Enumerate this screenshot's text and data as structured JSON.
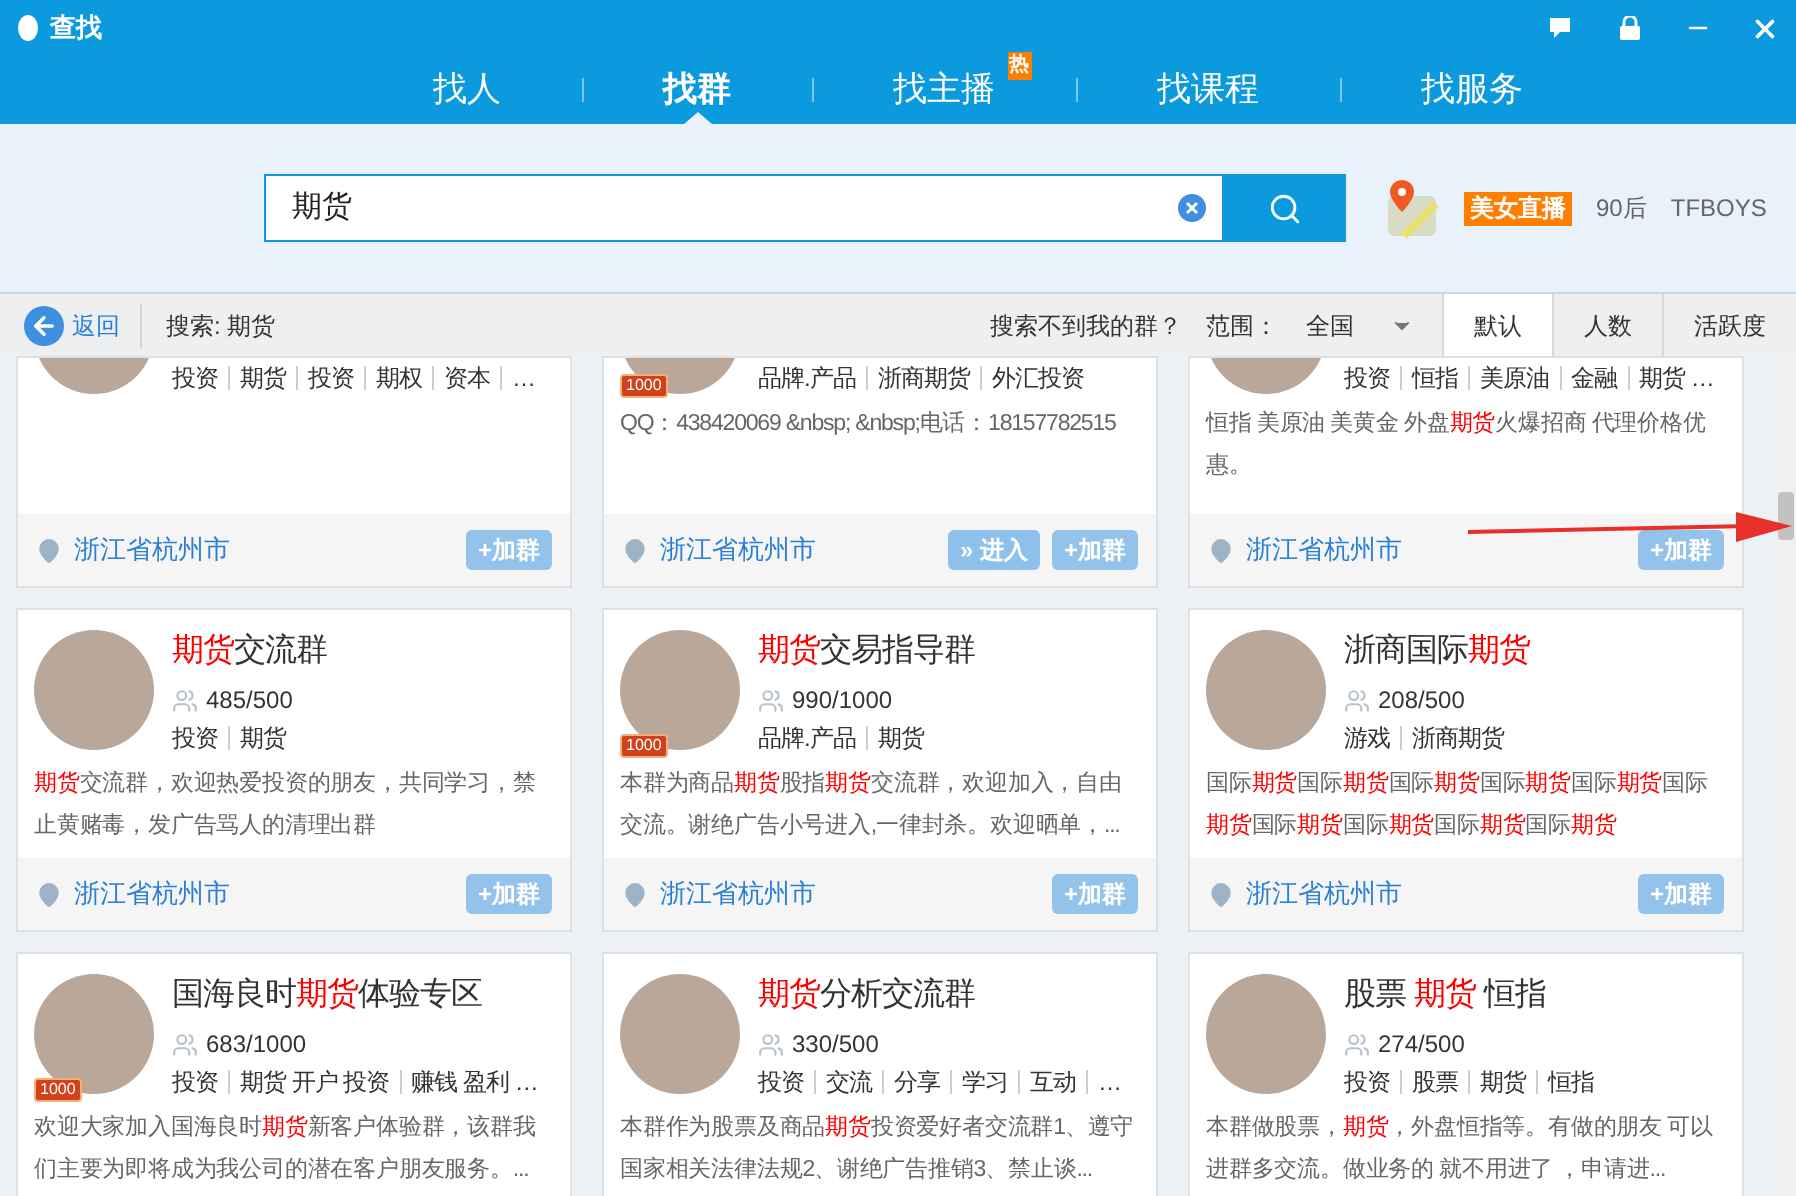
{
  "window": {
    "title": "查找"
  },
  "tabs": [
    {
      "label": "找人",
      "selected": false
    },
    {
      "label": "找群",
      "selected": true
    },
    {
      "label": "找主播",
      "selected": false,
      "badge": "热"
    },
    {
      "label": "找课程",
      "selected": false
    },
    {
      "label": "找服务",
      "selected": false
    }
  ],
  "search": {
    "value": "期货",
    "hot": [
      {
        "label": "美女直播",
        "kind": "badge"
      },
      {
        "label": "90后",
        "kind": "plain"
      },
      {
        "label": "TFBOYS",
        "kind": "plain"
      }
    ]
  },
  "toolbar": {
    "back": "返回",
    "query": "搜索: 期货",
    "help": "搜索不到我的群？",
    "range_label": "范围：",
    "range": "全国",
    "sorts": [
      {
        "label": "默认",
        "selected": true
      },
      {
        "label": "人数",
        "selected": false
      },
      {
        "label": "活跃度",
        "selected": false
      }
    ]
  },
  "rows": [
    {
      "cards": [
        {
          "tags": [
            "投资",
            "期货",
            "投资",
            "期权",
            "资本",
            "…"
          ],
          "location": "浙江省杭州市",
          "buttons": [
            {
              "label": "+加群",
              "kind": "join"
            }
          ]
        },
        {
          "badge": "1000",
          "tags": [
            "品牌.产品",
            "浙商期货",
            "外汇投资"
          ],
          "desc": [
            {
              "text": "QQ：438420069 &nbsp; &nbsp;电话：18157782515",
              "hl": false
            }
          ],
          "location": "浙江省杭州市",
          "buttons": [
            {
              "label": "» 进入",
              "kind": "enter"
            },
            {
              "label": "+加群",
              "kind": "join"
            }
          ]
        },
        {
          "tags": [
            "投资",
            "恒指",
            "美原油",
            "金融",
            "期货 …"
          ],
          "desc": [
            {
              "text": "恒指 美原油 美黄金 外盘",
              "hl": false
            },
            {
              "text": "期货",
              "hl": true
            },
            {
              "text": "火爆招商 代理价格优惠。",
              "hl": false
            }
          ],
          "location": "浙江省杭州市",
          "buttons": [
            {
              "label": "+加群",
              "kind": "join"
            }
          ]
        }
      ]
    },
    {
      "cards": [
        {
          "name": [
            {
              "text": "期货",
              "hl": true
            },
            {
              "text": "交流群",
              "hl": false
            }
          ],
          "count": "485/500",
          "tags": [
            "投资",
            "期货"
          ],
          "desc": [
            {
              "text": "期货",
              "hl": true
            },
            {
              "text": "交流群，欢迎热爱投资的朋友，共同学习，禁止黄赌毒，发广告骂人的清理出群",
              "hl": false
            }
          ],
          "location": "浙江省杭州市",
          "buttons": [
            {
              "label": "+加群",
              "kind": "join"
            }
          ]
        },
        {
          "badge": "1000",
          "name": [
            {
              "text": "期货",
              "hl": true
            },
            {
              "text": "交易指导群",
              "hl": false
            }
          ],
          "count": "990/1000",
          "tags": [
            "品牌.产品",
            "期货"
          ],
          "desc": [
            {
              "text": "本群为商品",
              "hl": false
            },
            {
              "text": "期货",
              "hl": true
            },
            {
              "text": "股指",
              "hl": false
            },
            {
              "text": "期货",
              "hl": true
            },
            {
              "text": "交流群，欢迎加入，自由交流。谢绝广告小号进入,一律封杀。欢迎晒单，...",
              "hl": false
            }
          ],
          "location": "浙江省杭州市",
          "buttons": [
            {
              "label": "+加群",
              "kind": "join"
            }
          ]
        },
        {
          "name": [
            {
              "text": "浙商国际",
              "hl": false
            },
            {
              "text": "期货",
              "hl": true
            }
          ],
          "count": "208/500",
          "tags": [
            "游戏",
            "浙商期货"
          ],
          "desc": [
            {
              "text": "国际",
              "hl": false
            },
            {
              "text": "期货",
              "hl": true
            },
            {
              "text": "国际",
              "hl": false
            },
            {
              "text": "期货",
              "hl": true
            },
            {
              "text": "国际",
              "hl": false
            },
            {
              "text": "期货",
              "hl": true
            },
            {
              "text": "国际",
              "hl": false
            },
            {
              "text": "期货",
              "hl": true
            },
            {
              "text": "国际",
              "hl": false
            },
            {
              "text": "期货",
              "hl": true
            },
            {
              "text": "国际",
              "hl": false
            },
            {
              "text": "期货",
              "hl": true
            },
            {
              "text": "国际",
              "hl": false
            },
            {
              "text": "期货",
              "hl": true
            },
            {
              "text": "国际",
              "hl": false
            },
            {
              "text": "期货",
              "hl": true
            },
            {
              "text": "国际",
              "hl": false
            },
            {
              "text": "期货",
              "hl": true
            },
            {
              "text": "国际",
              "hl": false
            },
            {
              "text": "期货",
              "hl": true
            }
          ],
          "location": "浙江省杭州市",
          "buttons": [
            {
              "label": "+加群",
              "kind": "join"
            }
          ]
        }
      ]
    },
    {
      "cards": [
        {
          "badge": "1000",
          "name": [
            {
              "text": "国海良时",
              "hl": false
            },
            {
              "text": "期货",
              "hl": true
            },
            {
              "text": "体验专区",
              "hl": false
            }
          ],
          "count": "683/1000",
          "tags": [
            "投资",
            "期货 开户 投资",
            "赚钱 盈利 …"
          ],
          "desc": [
            {
              "text": "欢迎大家加入国海良时",
              "hl": false
            },
            {
              "text": "期货",
              "hl": true
            },
            {
              "text": "新客户体验群，该群我们主要为即将成为我公司的潜在客户朋友服务。...",
              "hl": false
            }
          ]
        },
        {
          "name": [
            {
              "text": "期货",
              "hl": true
            },
            {
              "text": "分析交流群",
              "hl": false
            }
          ],
          "count": "330/500",
          "tags": [
            "投资",
            "交流",
            "分享",
            "学习",
            "互动",
            "…"
          ],
          "desc": [
            {
              "text": "本群作为股票及商品",
              "hl": false
            },
            {
              "text": "期货",
              "hl": true
            },
            {
              "text": "投资爱好者交流群1、遵守国家相关法律法规2、谢绝广告推销3、禁止谈...",
              "hl": false
            }
          ]
        },
        {
          "name": [
            {
              "text": "股票 ",
              "hl": false
            },
            {
              "text": "期货",
              "hl": true
            },
            {
              "text": " 恒指",
              "hl": false
            }
          ],
          "count": "274/500",
          "tags": [
            "投资",
            "股票",
            "期货",
            "恒指"
          ],
          "desc": [
            {
              "text": "本群做股票，",
              "hl": false
            },
            {
              "text": "期货",
              "hl": true
            },
            {
              "text": "，外盘恒指等。有做的朋友 可以进群多交流。做业务的 就不用进了 ，申请进...",
              "hl": false
            }
          ]
        }
      ]
    }
  ]
}
